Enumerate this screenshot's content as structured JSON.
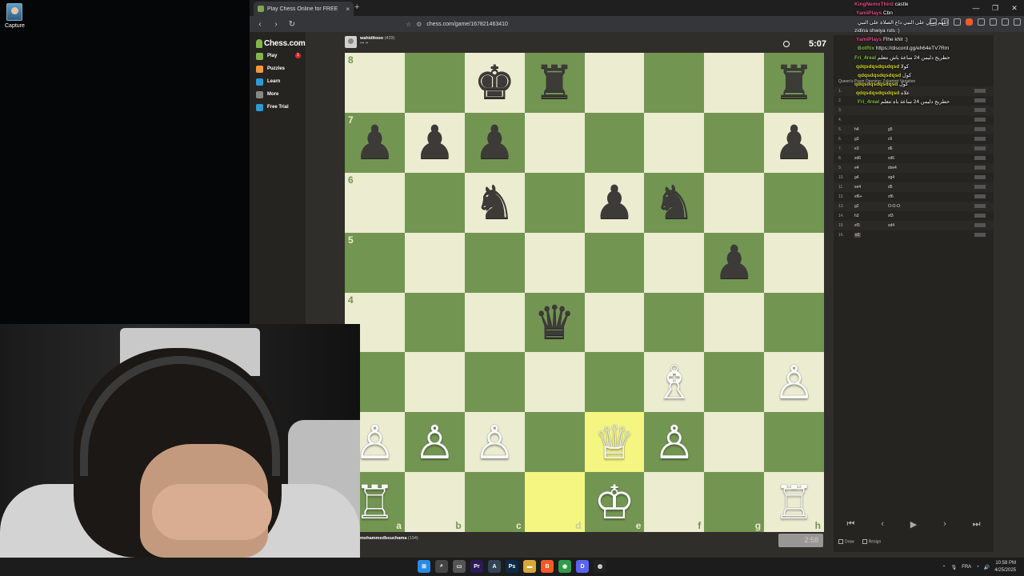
{
  "desktop": {
    "icon_label": "Capture"
  },
  "browser": {
    "tab_title": "Play Chess Online for FREE",
    "tab_close": "×",
    "new_tab": "+",
    "url": "chess.com/game/167821463410",
    "window_controls": [
      "—",
      "❐",
      "✕"
    ]
  },
  "sidebar": {
    "logo": "Chess.com",
    "items": [
      {
        "label": "Play",
        "icon": "pawn-icon",
        "color": "#81b64c",
        "badge": "1"
      },
      {
        "label": "Puzzles",
        "icon": "puzzle-icon",
        "color": "#f29b38"
      },
      {
        "label": "Learn",
        "icon": "graduation-icon",
        "color": "#2a9bd6"
      },
      {
        "label": "More",
        "icon": "chevron-down-icon",
        "color": "#888888"
      },
      {
        "label": "Free Trial",
        "icon": "diamond-icon",
        "color": "#2a9bd6"
      }
    ]
  },
  "players": {
    "top": {
      "name": "wahiditooo",
      "rating": "(429)"
    },
    "bottom": {
      "name": "mohammedbouchama",
      "rating": "(194)"
    }
  },
  "clocks": {
    "top": "5:07",
    "bottom": "2:58"
  },
  "board": {
    "ranks": [
      "8",
      "7",
      "6",
      "5",
      "4",
      "3",
      "2",
      "1"
    ],
    "files": [
      "a",
      "b",
      "c",
      "d",
      "e",
      "f",
      "g",
      "h"
    ],
    "position": [
      [
        "",
        "",
        "♚",
        "♜",
        "",
        "",
        "",
        "♜"
      ],
      [
        "♟",
        "♟",
        "♟",
        "",
        "",
        "",
        "",
        "♟"
      ],
      [
        "",
        "",
        "♞",
        "",
        "♟",
        "♞",
        "",
        ""
      ],
      [
        "",
        "",
        "",
        "",
        "",
        "",
        "♟",
        ""
      ],
      [
        "",
        "",
        "",
        "♛",
        "",
        "",
        "",
        ""
      ],
      [
        "",
        "",
        "",
        "",
        "",
        "♗",
        "",
        "♙"
      ],
      [
        "♙",
        "♙",
        "♙",
        "",
        "♕",
        "♙",
        "",
        ""
      ],
      [
        "♖",
        "",
        "",
        "",
        "♔",
        "",
        "",
        "♖"
      ]
    ],
    "white_pieces": [
      "♙",
      "♖",
      "♘",
      "♗",
      "♕",
      "♔"
    ],
    "highlighted": [
      "e2",
      "d1"
    ]
  },
  "panel": {
    "opening": "Queen's Pawn Opening: Zukertort Variation",
    "info": "Info",
    "moves": [
      {
        "n": "1.",
        "w": "",
        "b": ""
      },
      {
        "n": "2.",
        "w": "",
        "b": ""
      },
      {
        "n": "3.",
        "w": "",
        "b": ""
      },
      {
        "n": "4.",
        "w": "",
        "b": ""
      },
      {
        "n": "5.",
        "w": "h4",
        "b": "g5"
      },
      {
        "n": "6.",
        "w": "g3",
        "b": "c6"
      },
      {
        "n": "7.",
        "w": "e3",
        "b": "d6"
      },
      {
        "n": "8.",
        "w": "xd6",
        "b": "xd6"
      },
      {
        "n": "9.",
        "w": "e4",
        "b": "dxe4"
      },
      {
        "n": "10.",
        "w": "g4",
        "b": "xg4"
      },
      {
        "n": "11.",
        "w": "xe4",
        "b": "d5"
      },
      {
        "n": "12.",
        "w": "xf6+",
        "b": "xf6"
      },
      {
        "n": "13.",
        "w": "g2",
        "b": "O-O-O"
      },
      {
        "n": "14.",
        "w": "h3",
        "b": "xf3"
      },
      {
        "n": "15.",
        "w": "xf3",
        "b": "xd4"
      },
      {
        "n": "16.",
        "w": "e2",
        "b": ""
      }
    ],
    "controls": [
      "⏮",
      "‹",
      "▶",
      "›",
      "⏭"
    ],
    "actions": [
      "Draw",
      "Resign"
    ]
  },
  "chat": [
    {
      "user": "KingNemoThird",
      "text": "castle",
      "color": "#e94b8a"
    },
    {
      "user": "YamiPlays",
      "text": "Cbn",
      "color": "#e94b8a"
    },
    {
      "user": "",
      "text": "اللهم صلي على النبي داع الصلاة على النبي",
      "color": "#ffffff"
    },
    {
      "user": "",
      "text": "zidlna shwiya rols :)",
      "color": "#ffffff"
    },
    {
      "user": "YamiPlays",
      "text": "Flhe khlr :)",
      "color": "#e94b8a"
    },
    {
      "user": "BotRix",
      "text": "https://discord.gg/eh64eTV7Rm",
      "color": "#7fc143"
    },
    {
      "user": "Fri_4real",
      "text": "حطريج دليمن 24 ساعة باش تتعلم",
      "color": "#7fc143"
    },
    {
      "user": "qdqsdqsdqsdqsd",
      "text": "كولا",
      "color": "#d9d92e"
    },
    {
      "user": "qdqsdqsdqsdqsd",
      "text": "كول",
      "color": "#d9d92e"
    },
    {
      "user": "qdqsdqsdqsdqsd",
      "text": "كول",
      "color": "#d9d92e"
    },
    {
      "user": "qdqsdqsdqsdqsd",
      "text": "علاه",
      "color": "#d9d92e"
    },
    {
      "user": "Fri_4real",
      "text": "حطريج دليمن 24 ساعة باه تتعلم",
      "color": "#7fc143"
    }
  ],
  "taskbar": {
    "apps": [
      {
        "name": "windows-icon",
        "color": "#2a8ae6",
        "glyph": "⊞"
      },
      {
        "name": "search-icon",
        "color": "#444444",
        "glyph": "⌕"
      },
      {
        "name": "files-icon",
        "color": "#555555",
        "glyph": "▭"
      },
      {
        "name": "premiere-icon",
        "color": "#2a1a55",
        "glyph": "Pr"
      },
      {
        "name": "app-icon",
        "color": "#334455",
        "glyph": "A"
      },
      {
        "name": "photoshop-icon",
        "color": "#0c2a4a",
        "glyph": "Ps"
      },
      {
        "name": "folder-icon",
        "color": "#d9a63a",
        "glyph": "▬"
      },
      {
        "name": "brave-icon",
        "color": "#f15a29",
        "glyph": "B"
      },
      {
        "name": "chrome-icon",
        "color": "#2e9c49",
        "glyph": "◉"
      },
      {
        "name": "discord-icon",
        "color": "#5865f2",
        "glyph": "D"
      },
      {
        "name": "obs-icon",
        "color": "#222222",
        "glyph": "◍"
      }
    ],
    "lang": "FRA",
    "time": "10:58 PM",
    "date": "4/25/2025"
  }
}
